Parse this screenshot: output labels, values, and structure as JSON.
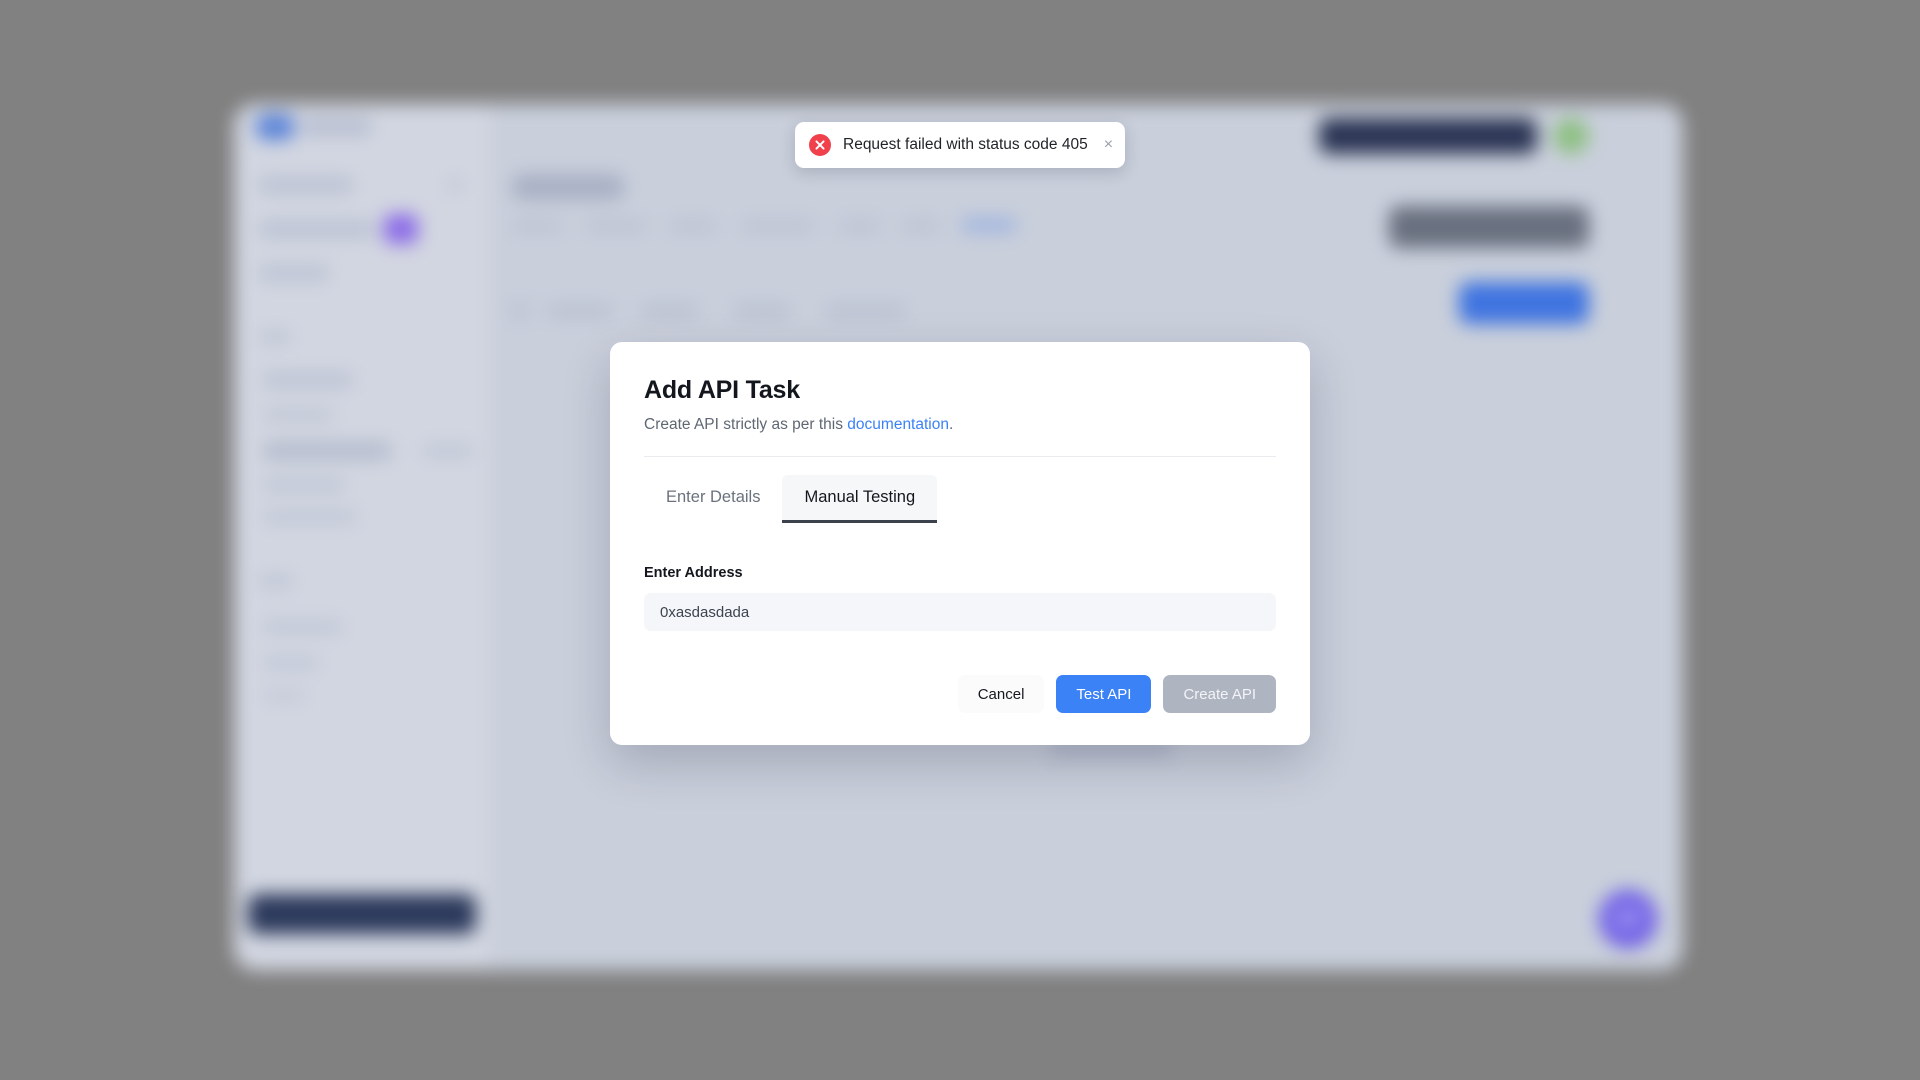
{
  "toast": {
    "icon": "error-circle-icon",
    "message": "Request failed with status code 405",
    "close_label": "×"
  },
  "modal": {
    "title": "Add API Task",
    "subtitle_before": "Create API strictly as per this ",
    "subtitle_link": "documentation",
    "subtitle_after": ".",
    "tabs": [
      {
        "label": "Enter Details",
        "active": false
      },
      {
        "label": "Manual Testing",
        "active": true
      }
    ],
    "field": {
      "label": "Enter Address",
      "value": "0xasdasdada",
      "placeholder": "Enter Address"
    },
    "actions": {
      "cancel_label": "Cancel",
      "test_label": "Test API",
      "create_label": "Create API"
    }
  },
  "app_background": {
    "chat_widget_icon": "chat-bubble-icon"
  },
  "colors": {
    "accent_blue": "#3b82f6",
    "error_red": "#f0404b",
    "chat_purple": "#6c5ce7",
    "disabled_gray": "#aeb5c0",
    "tab_active_underline": "#3c424c",
    "input_background": "#f4f6fa",
    "backdrop_gray": "#818181"
  }
}
